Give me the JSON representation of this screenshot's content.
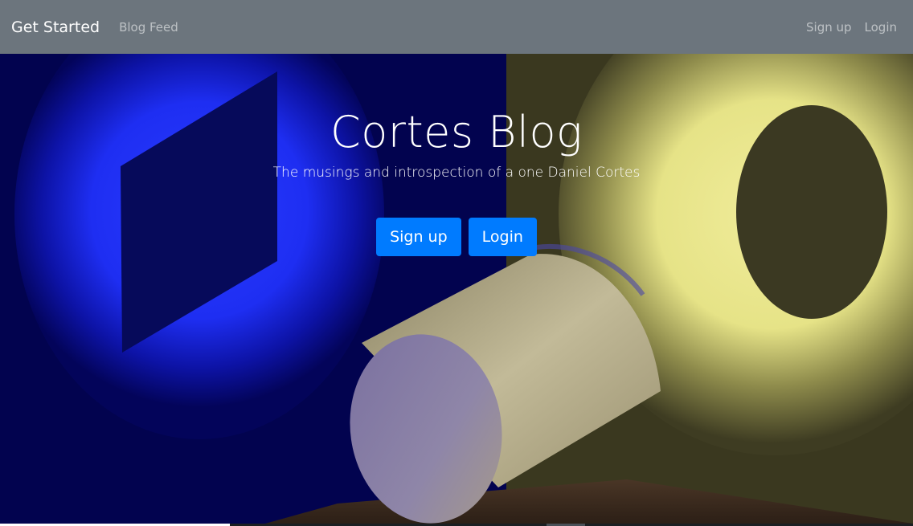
{
  "navbar": {
    "brand": "Get Started",
    "links": [
      {
        "label": "Blog Feed"
      }
    ],
    "right_links": [
      {
        "label": "Sign up"
      },
      {
        "label": "Login"
      }
    ],
    "background": "#6c757d"
  },
  "hero": {
    "title": "Cortes Blog",
    "subtitle": "The musings and introspection of a one Daniel Cortes",
    "buttons": [
      {
        "label": "Sign up"
      },
      {
        "label": "Login"
      }
    ],
    "button_color": "#007bff"
  }
}
